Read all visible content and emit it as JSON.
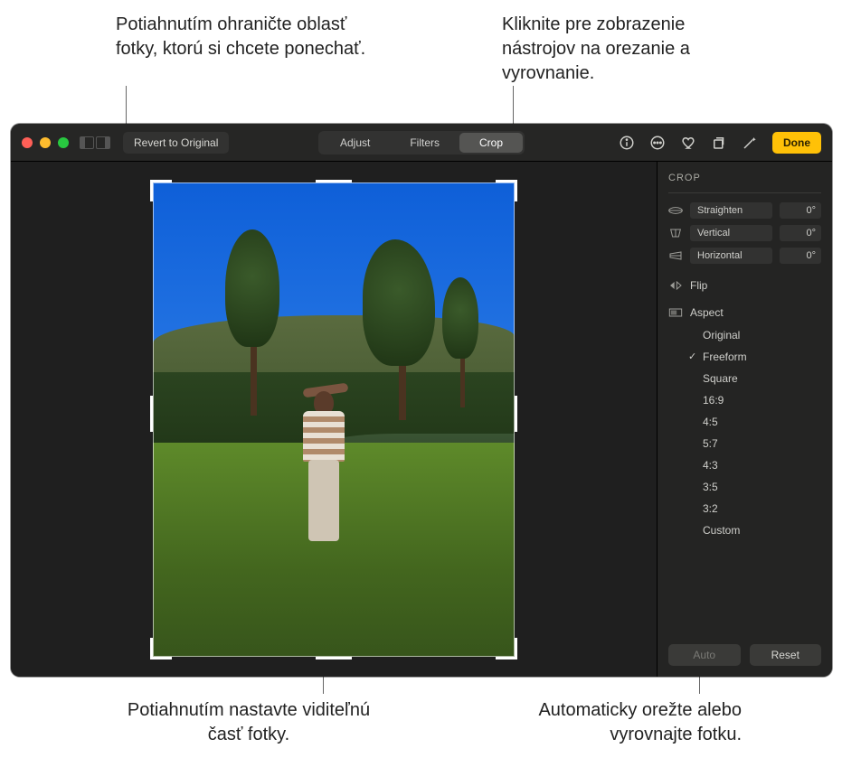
{
  "callouts": {
    "top_left": "Potiahnutím ohraničte oblasť fotky, ktorú si chcete ponechať.",
    "top_right": "Kliknite pre zobrazenie nástrojov na orezanie a vyrovnanie.",
    "bottom_left": "Potiahnutím nastavte viditeľnú časť fotky.",
    "bottom_right": "Automaticky orežte alebo vyrovnajte fotku."
  },
  "toolbar": {
    "revert": "Revert to Original",
    "done": "Done"
  },
  "tabs": {
    "adjust": "Adjust",
    "filters": "Filters",
    "crop": "Crop"
  },
  "sidebar": {
    "title": "CROP",
    "straighten": {
      "label": "Straighten",
      "value": "0°"
    },
    "vertical": {
      "label": "Vertical",
      "value": "0°"
    },
    "horizontal": {
      "label": "Horizontal",
      "value": "0°"
    },
    "flip": "Flip",
    "aspect_label": "Aspect",
    "aspect": {
      "original": "Original",
      "freeform": "Freeform",
      "square": "Square",
      "r16_9": "16:9",
      "r4_5": "4:5",
      "r5_7": "5:7",
      "r4_3": "4:3",
      "r3_5": "3:5",
      "r3_2": "3:2",
      "custom": "Custom"
    },
    "auto": "Auto",
    "reset": "Reset"
  }
}
